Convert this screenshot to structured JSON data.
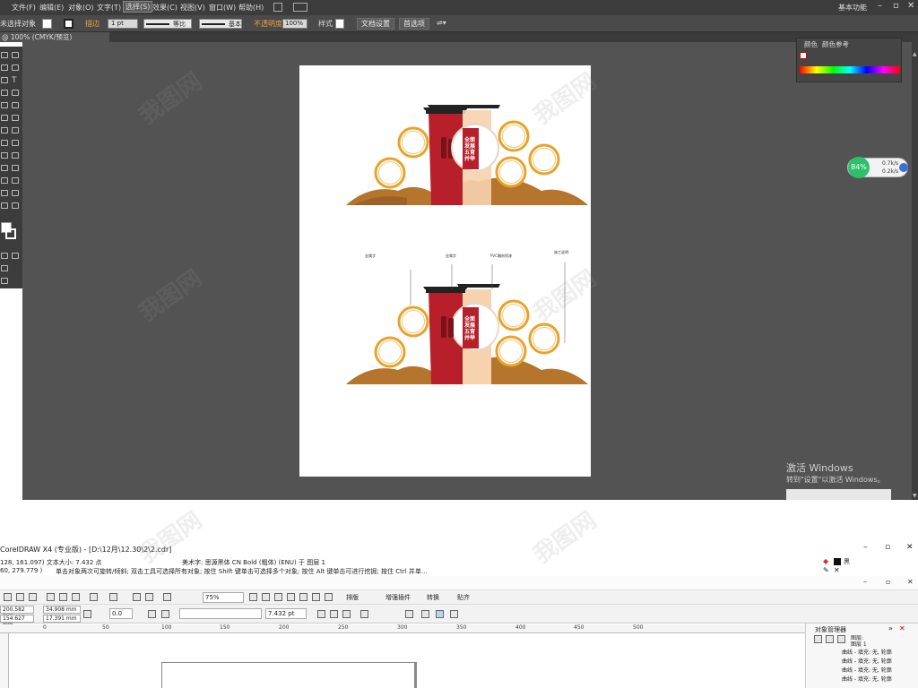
{
  "illustrator": {
    "menu": [
      "文件(F)",
      "编辑(E)",
      "对象(O)",
      "文字(T)",
      "选择(S)",
      "效果(C)",
      "视图(V)",
      "窗口(W)",
      "帮助(H)"
    ],
    "workspace": "基本功能",
    "control": {
      "no_selection": "未选择对象",
      "stroke_label": "描边",
      "stroke_value": "1 pt",
      "profile": "等比",
      "brush": "基本",
      "opacity_label": "不透明度",
      "opacity_value": "100%",
      "style_label": "样式",
      "doc_setup": "文档设置",
      "preferences": "首选项"
    },
    "tab": "@ 100% (CMYK/预览)",
    "color_panel": {
      "tab_color": "颜色",
      "tab_guide": "颜色参考"
    },
    "net": {
      "percent": "84%",
      "up": "0.7k/s",
      "down": "0.2k/s"
    },
    "activate": {
      "line1": "激活 Windows",
      "line2": "转到\"设置\"以激活 Windows。"
    },
    "artwork": {
      "banner_text": "全面发展 五育并举",
      "ann1_title": "金属字",
      "ann2_title": "金属字",
      "ann3_title": "PVC雕刻喷漆",
      "ann4_title": "施工说明:"
    }
  },
  "corel": {
    "title": "CorelDRAW X4 (专业版) - [D:\\12月\\12.30\\2\\2.cdr]",
    "status1_left": "128, 161.097)  文本大小: 7.432 点",
    "status1_right": "美术字: 思源黑体 CN Bold (粗体) (ENU) 于 图层 1",
    "status2_left": "60, 279.779 )",
    "status2_right": "单击对象两次可旋转/倾斜; 双击工具可选择所有对象; 按住 Shift 键单击可选择多个对象; 按住 Alt 键单击可进行挖掘; 按住 Ctrl 并单...",
    "fill_label": "黑",
    "zoom": "75%",
    "layout_menu": "排版",
    "enhance_menu": "增强插件",
    "convert_menu": "转换",
    "paste_menu": "贴齐",
    "pos_x": "200.582 mm",
    "pos_y": "154.627 mm",
    "size_w": "34.908 mm",
    "size_h": "17.391 mm",
    "angle": "0.0",
    "font_size": "7.432 pt",
    "ruler": [
      "0",
      "50",
      "100",
      "150",
      "200",
      "250",
      "300",
      "350",
      "400",
      "450",
      "500"
    ],
    "objmgr_title": "对象管理器",
    "layer1": "图层:",
    "layer2": "图层 1",
    "objects": [
      "曲线 - 填充: 无, 轮廓",
      "曲线 - 填充: 无, 轮廓",
      "曲线 - 填充: 无, 轮廓",
      "曲线 - 填充: 无, 轮廓"
    ]
  },
  "watermark": "我图网"
}
